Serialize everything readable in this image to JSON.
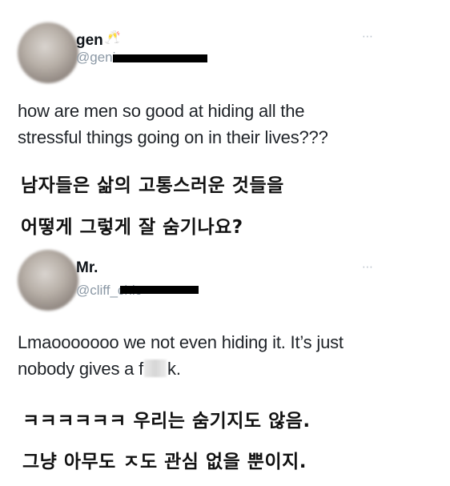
{
  "tweet1": {
    "name": "gen",
    "name_emoji": "🥂",
    "handle": "@genima",
    "more_icon": "⋯",
    "text_line1": "how are men so good at hiding all the",
    "text_line2": "stressful things going on in their lives???",
    "translation_line1": "남자들은 삶의 고통스러운 것들을",
    "translation_line2": "어떻게 그렇게 잘 숨기나요?"
  },
  "tweet2": {
    "name": "Mr.",
    "handle": "@cliff_chic",
    "more_icon": "⋯",
    "text_line1": "Lmaooooooo we not even hiding it. It’s just",
    "text_line2_before": "nobody gives a f",
    "text_line2_after": "k.",
    "translation_line1": "ㅋㅋㅋㅋㅋㅋ 우리는 숨기지도 않음.",
    "translation_line2": "그냥 아무도 ㅈ도 관심 없을 뿐이지."
  }
}
